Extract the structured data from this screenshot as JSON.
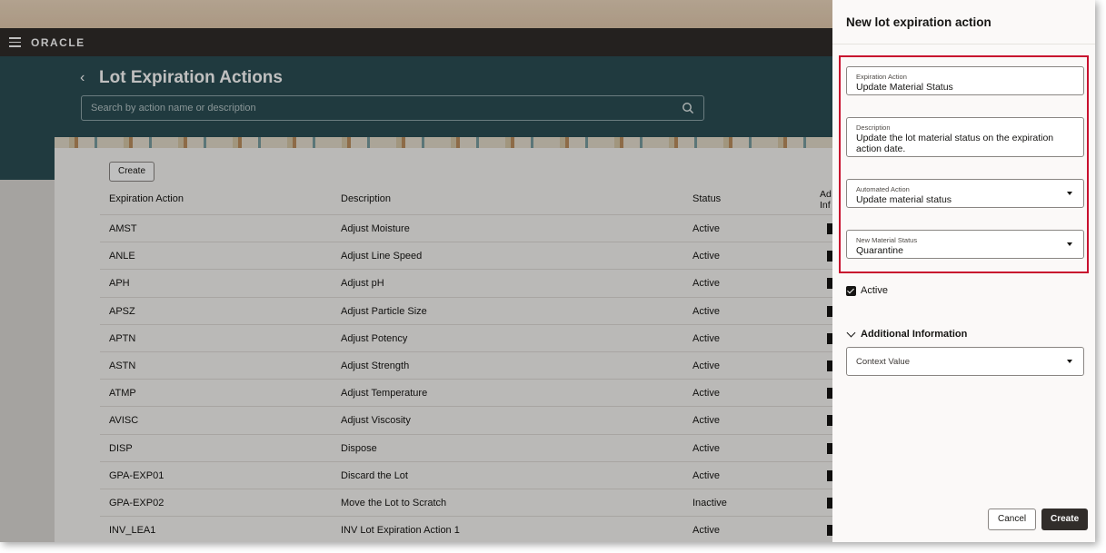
{
  "app": {
    "brand": "ORACLE"
  },
  "page": {
    "title": "Lot Expiration Actions",
    "search_placeholder": "Search by action name or description",
    "create_label": "Create"
  },
  "table": {
    "headers": [
      "Expiration Action",
      "Description",
      "Status",
      "Ad\nInf"
    ],
    "rows": [
      {
        "action": "AMST",
        "description": "Adjust Moisture",
        "status": "Active"
      },
      {
        "action": "ANLE",
        "description": "Adjust Line Speed",
        "status": "Active"
      },
      {
        "action": "APH",
        "description": "Adjust pH",
        "status": "Active"
      },
      {
        "action": "APSZ",
        "description": "Adjust Particle Size",
        "status": "Active"
      },
      {
        "action": "APTN",
        "description": "Adjust Potency",
        "status": "Active"
      },
      {
        "action": "ASTN",
        "description": "Adjust Strength",
        "status": "Active"
      },
      {
        "action": "ATMP",
        "description": "Adjust Temperature",
        "status": "Active"
      },
      {
        "action": "AVISC",
        "description": "Adjust Viscosity",
        "status": "Active"
      },
      {
        "action": "DISP",
        "description": "Dispose",
        "status": "Active"
      },
      {
        "action": "GPA-EXP01",
        "description": "Discard the Lot",
        "status": "Active"
      },
      {
        "action": "GPA-EXP02",
        "description": "Move the Lot to Scratch",
        "status": "Inactive"
      },
      {
        "action": "INV_LEA1",
        "description": "INV Lot Expiration Action 1",
        "status": "Active"
      }
    ]
  },
  "drawer": {
    "title": "New lot expiration action",
    "fields": {
      "expiration_action": {
        "label": "Expiration Action",
        "value": "Update Material Status"
      },
      "description": {
        "label": "Description",
        "value": "Update the lot material status on the expiration action date."
      },
      "automated_action": {
        "label": "Automated Action",
        "value": "Update material status"
      },
      "new_material_status": {
        "label": "New Material Status",
        "value": "Quarantine"
      }
    },
    "active_label": "Active",
    "active_checked": true,
    "additional_info_title": "Additional Information",
    "context_value_placeholder": "Context Value",
    "cancel_label": "Cancel",
    "create_label": "Create"
  },
  "colors": {
    "highlight": "#c8102e",
    "hero": "#2b4e54",
    "appbar": "#312d2a"
  }
}
